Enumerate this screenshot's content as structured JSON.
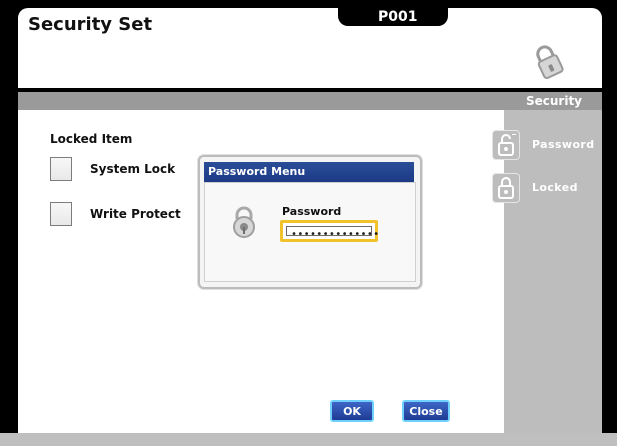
{
  "header": {
    "title": "Security Set",
    "page_code": "P001",
    "security_label": "Security"
  },
  "main": {
    "locked_item_title": "Locked Item",
    "options": [
      {
        "label": "System Lock",
        "checked": false
      },
      {
        "label": "Write Protect",
        "checked": false
      }
    ]
  },
  "sidebar": {
    "items": [
      {
        "label": "Password",
        "icon": "open-padlock-icon"
      },
      {
        "label": "Locked",
        "icon": "closed-padlock-icon"
      }
    ]
  },
  "dialog": {
    "title": "Password Menu",
    "field_label": "Password",
    "masked_value": "••••••••••••••"
  },
  "buttons": {
    "ok_label": "OK",
    "close_label": "Close"
  },
  "colors": {
    "background": "#000000",
    "panel": "#ffffff",
    "separator": "#9a9a9a",
    "sidebar": "#bdbdbd",
    "dialog_title": "#1d3a86",
    "focus_outline": "#f0c22c",
    "button": "#1e3b94",
    "button_border": "#6fd0ff"
  }
}
